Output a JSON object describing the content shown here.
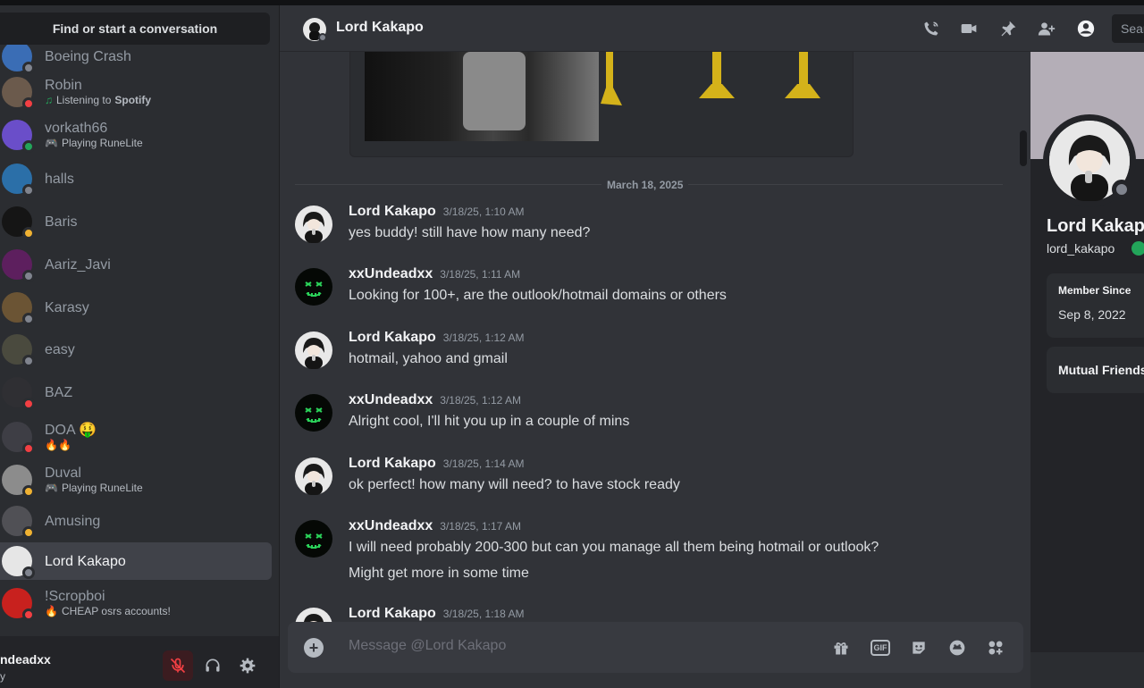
{
  "sidebar": {
    "search_label": "Find or start a conversation",
    "dms": [
      {
        "name": "Boeing Crash",
        "status": "off",
        "avatar_color": "#3a6db5"
      },
      {
        "name": "Robin",
        "status": "dnd",
        "sub_prefix": "Listening to ",
        "sub_bold": "Spotify",
        "sub_icon": "♫",
        "avatar_color": "#6b5a4c"
      },
      {
        "name": "vorkath66",
        "status": "online",
        "sub_prefix": "Playing RuneLite",
        "sub_bold": "",
        "sub_icon": "🎮",
        "avatar_color": "#6a4ec9"
      },
      {
        "name": "halls",
        "status": "off",
        "avatar_color": "#2b6fa8"
      },
      {
        "name": "Baris",
        "status": "idle",
        "avatar_color": "#151515"
      },
      {
        "name": "Aariz_Javi",
        "status": "off",
        "avatar_color": "#5d1f5e"
      },
      {
        "name": "Karasy",
        "status": "off",
        "avatar_color": "#6b5434"
      },
      {
        "name": "easy",
        "status": "off",
        "avatar_color": "#4a4a3e"
      },
      {
        "name": "BAZ",
        "status": "dnd",
        "avatar_color": "#2f2f33"
      },
      {
        "name": "DOA 🤑",
        "status": "dnd",
        "sub_prefix": "🔥🔥",
        "sub_bold": "",
        "sub_icon": "",
        "avatar_color": "#3e3e45"
      },
      {
        "name": "Duval",
        "status": "idle",
        "sub_prefix": "Playing RuneLite",
        "sub_bold": "",
        "sub_icon": "🎮",
        "avatar_color": "#8c8c8c"
      },
      {
        "name": "Amusing",
        "status": "idle",
        "avatar_color": "#505055"
      },
      {
        "name": "Lord Kakapo",
        "status": "off",
        "active": true,
        "avatar_color": "#e6e6e6"
      },
      {
        "name": "!Scropboi",
        "status": "dnd",
        "sub_prefix": "CHEAP osrs accounts!",
        "sub_bold": "",
        "sub_icon": "🔥",
        "avatar_color": "#c8211e"
      }
    ]
  },
  "user_panel": {
    "name": "ndeadxx",
    "sub": "y"
  },
  "header": {
    "title": "Lord Kakapo",
    "search_placeholder": "Sear"
  },
  "chat": {
    "date_divider": "March 18, 2025",
    "messages": [
      {
        "author": "Lord Kakapo",
        "time": "3/18/25, 1:10 AM",
        "lines": [
          "yes buddy! still have how many need?"
        ],
        "avatar": "kakapo"
      },
      {
        "author": "xxUndeadxx",
        "time": "3/18/25, 1:11 AM",
        "lines": [
          "Looking for 100+, are the outlook/hotmail domains or others"
        ],
        "avatar": "undead"
      },
      {
        "author": "Lord Kakapo",
        "time": "3/18/25, 1:12 AM",
        "lines": [
          "hotmail, yahoo and gmail"
        ],
        "avatar": "kakapo"
      },
      {
        "author": "xxUndeadxx",
        "time": "3/18/25, 1:12 AM",
        "lines": [
          "Alright cool, I'll hit you up in a couple of mins"
        ],
        "avatar": "undead"
      },
      {
        "author": "Lord Kakapo",
        "time": "3/18/25, 1:14 AM",
        "lines": [
          "ok perfect! how many will need? to have stock ready"
        ],
        "avatar": "kakapo"
      },
      {
        "author": "xxUndeadxx",
        "time": "3/18/25, 1:17 AM",
        "lines": [
          "I will need probably 200-300 but can you manage all them being hotmail or outlook?",
          "Might get more in some time"
        ],
        "avatar": "undead"
      },
      {
        "author": "Lord Kakapo",
        "time": "3/18/25, 1:18 AM",
        "lines": [
          ""
        ],
        "avatar": "kakapo"
      }
    ],
    "composer_placeholder": "Message @Lord Kakapo"
  },
  "profile": {
    "name": "Lord Kakapo",
    "username": "lord_kakapo",
    "member_since_label": "Member Since",
    "member_since_value": "Sep 8, 2022",
    "mutual_friends_label": "Mutual Friends"
  },
  "colors": {
    "online": "#23a55a",
    "idle": "#f0b232",
    "dnd": "#f23f43",
    "offline": "#80848e",
    "undead_green": "#2bd35a"
  }
}
